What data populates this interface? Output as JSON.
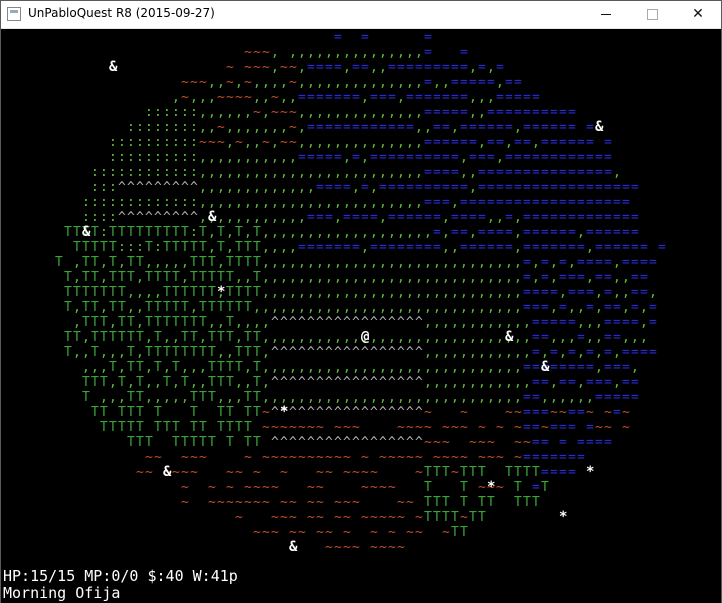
{
  "window": {
    "title": "UnPabloQuest R8 (2015-09-27)",
    "controls": [
      "minimize",
      "maximize",
      "close"
    ]
  },
  "status": {
    "line1": "HP:15/15 MP:0/0 $:40 W:41p",
    "line2": "Morning Ofija"
  },
  "legend_colors": {
    "water": "#2a2ad6",
    "grass": "#5fbf3a",
    "forest": "#3aa33a",
    "mountain": "#b0b0b0",
    "hills": "#c0502a",
    "text": "#ffffff"
  },
  "map": {
    "player": "@",
    "npc_symbol": "&",
    "item_symbol": "*",
    "terrain_glyphs": {
      "water": "=",
      "grass": ",",
      "forest": "T",
      "mountain": "^",
      "hills": "~",
      "brush": ":"
    }
  }
}
